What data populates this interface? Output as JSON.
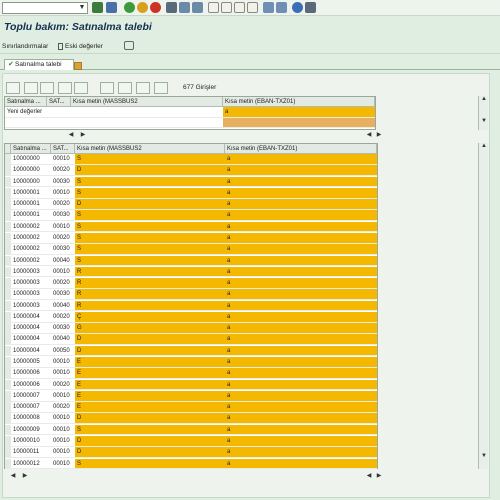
{
  "window": {
    "title": "Toplu bakım: Satınalma talebi",
    "command_field": {
      "value": "",
      "placeholder": ""
    }
  },
  "toolbar": {
    "icons": [
      "enter-icon",
      "save-icon",
      "back-icon",
      "exit-icon",
      "cancel-icon",
      "print-icon",
      "find-icon",
      "find-next-icon",
      "first-page-icon",
      "prev-page-icon",
      "next-page-icon",
      "last-page-icon",
      "new-session-icon",
      "shortcut-icon",
      "help-icon",
      "customize-icon"
    ]
  },
  "appbar": {
    "restrictions_label": "Sınırlandırmalar",
    "old_values_label": "Eski değerler"
  },
  "tab": {
    "label": "Satınalma talebi"
  },
  "entries_label": "677 Girişler",
  "top_grid": {
    "headers": [
      "Satınalma ...",
      "SAT...",
      "Kısa metin (MASSBUS2",
      "Kısa metin (EBAN-TXZ01)"
    ],
    "row_label": "Yeni değerler",
    "new_value": "a"
  },
  "main_grid": {
    "headers": [
      "Satınalma ...",
      "SAT...",
      "Kısa metin (MASSBUS2",
      "Kısa metin (EBAN-TXZ01)"
    ],
    "rows": [
      {
        "pr": "10000000",
        "item": "00010",
        "txt": "S",
        "new": "a"
      },
      {
        "pr": "10000000",
        "item": "00020",
        "txt": "D",
        "new": "a"
      },
      {
        "pr": "10000000",
        "item": "00030",
        "txt": "S",
        "new": "a"
      },
      {
        "pr": "10000001",
        "item": "00010",
        "txt": "S",
        "new": "a"
      },
      {
        "pr": "10000001",
        "item": "00020",
        "txt": "D",
        "new": "a"
      },
      {
        "pr": "10000001",
        "item": "00030",
        "txt": "S",
        "new": "a"
      },
      {
        "pr": "10000002",
        "item": "00010",
        "txt": "S",
        "new": "a"
      },
      {
        "pr": "10000002",
        "item": "00020",
        "txt": "S",
        "new": "a"
      },
      {
        "pr": "10000002",
        "item": "00030",
        "txt": "S",
        "new": "a"
      },
      {
        "pr": "10000002",
        "item": "00040",
        "txt": "S",
        "new": "a"
      },
      {
        "pr": "10000003",
        "item": "00010",
        "txt": "R",
        "new": "a"
      },
      {
        "pr": "10000003",
        "item": "00020",
        "txt": "R",
        "new": "a"
      },
      {
        "pr": "10000003",
        "item": "00030",
        "txt": "R",
        "new": "a"
      },
      {
        "pr": "10000003",
        "item": "00040",
        "txt": "R",
        "new": "a"
      },
      {
        "pr": "10000004",
        "item": "00020",
        "txt": "Ç",
        "new": "a"
      },
      {
        "pr": "10000004",
        "item": "00030",
        "txt": "G",
        "new": "a"
      },
      {
        "pr": "10000004",
        "item": "00040",
        "txt": "D",
        "new": "a"
      },
      {
        "pr": "10000004",
        "item": "00050",
        "txt": "D",
        "new": "a"
      },
      {
        "pr": "10000005",
        "item": "00010",
        "txt": "E",
        "new": "a"
      },
      {
        "pr": "10000006",
        "item": "00010",
        "txt": "E",
        "new": "a"
      },
      {
        "pr": "10000006",
        "item": "00020",
        "txt": "E",
        "new": "a"
      },
      {
        "pr": "10000007",
        "item": "00010",
        "txt": "E",
        "new": "a"
      },
      {
        "pr": "10000007",
        "item": "00020",
        "txt": "E",
        "new": "a"
      },
      {
        "pr": "10000008",
        "item": "00010",
        "txt": "D",
        "new": "a"
      },
      {
        "pr": "10000009",
        "item": "00010",
        "txt": "S",
        "new": "a"
      },
      {
        "pr": "10000010",
        "item": "00010",
        "txt": "D",
        "new": "a"
      },
      {
        "pr": "10000011",
        "item": "00010",
        "txt": "D",
        "new": "a"
      },
      {
        "pr": "10000012",
        "item": "00010",
        "txt": "S",
        "new": "a"
      }
    ]
  },
  "colors": {
    "highlight": "#f5b800",
    "background": "#dfeee0",
    "title": "#15304f"
  }
}
